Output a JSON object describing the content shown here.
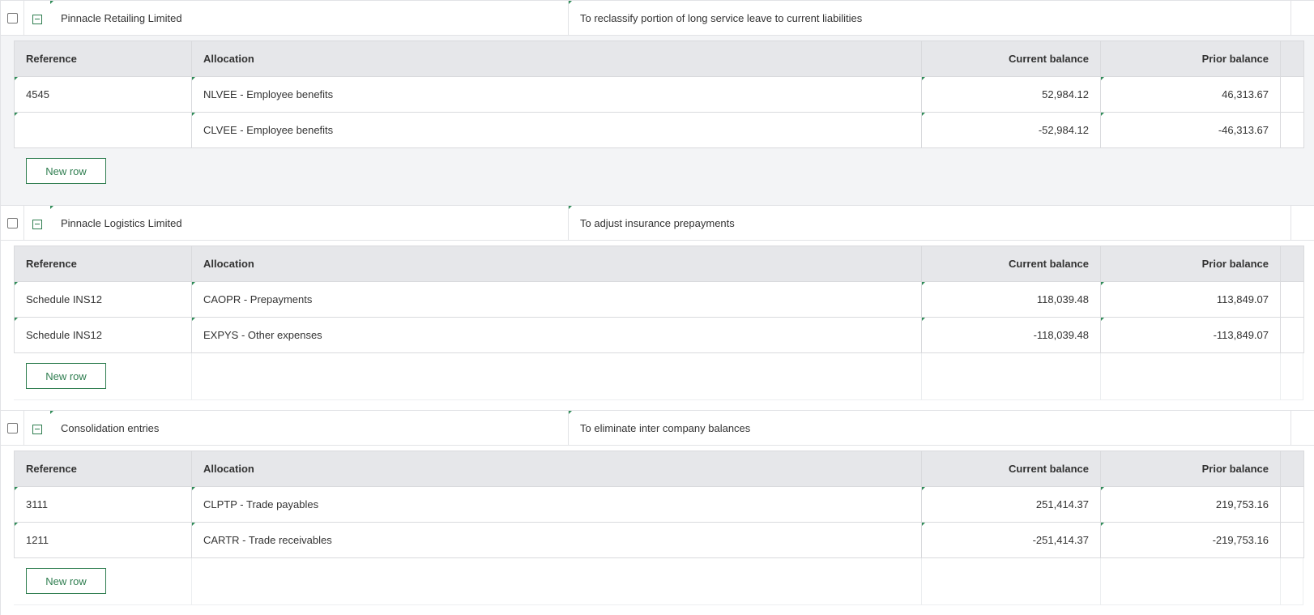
{
  "columns": {
    "reference": "Reference",
    "allocation": "Allocation",
    "current_balance": "Current balance",
    "prior_balance": "Prior balance"
  },
  "new_row_label": "New row",
  "entries": [
    {
      "entity": "Pinnacle Retailing Limited",
      "description": "To reclassify portion of long service leave to current liabilities",
      "rows": [
        {
          "reference": "4545",
          "allocation": "NLVEE - Employee benefits",
          "current": "52,984.12",
          "prior": "46,313.67"
        },
        {
          "reference": "",
          "allocation": "CLVEE - Employee benefits",
          "current": "-52,984.12",
          "prior": "-46,313.67"
        }
      ]
    },
    {
      "entity": "Pinnacle Logistics Limited",
      "description": "To adjust insurance prepayments",
      "rows": [
        {
          "reference": "Schedule INS12",
          "allocation": "CAOPR - Prepayments",
          "current": "118,039.48",
          "prior": "113,849.07"
        },
        {
          "reference": "Schedule INS12",
          "allocation": "EXPYS - Other expenses",
          "current": "-118,039.48",
          "prior": "-113,849.07"
        }
      ]
    },
    {
      "entity": "Consolidation entries",
      "description": "To eliminate inter company balances",
      "rows": [
        {
          "reference": "3111",
          "allocation": "CLPTP - Trade payables",
          "current": "251,414.37",
          "prior": "219,753.16"
        },
        {
          "reference": "1211",
          "allocation": "CARTR - Trade receivables",
          "current": "-251,414.37",
          "prior": "-219,753.16"
        }
      ]
    }
  ]
}
